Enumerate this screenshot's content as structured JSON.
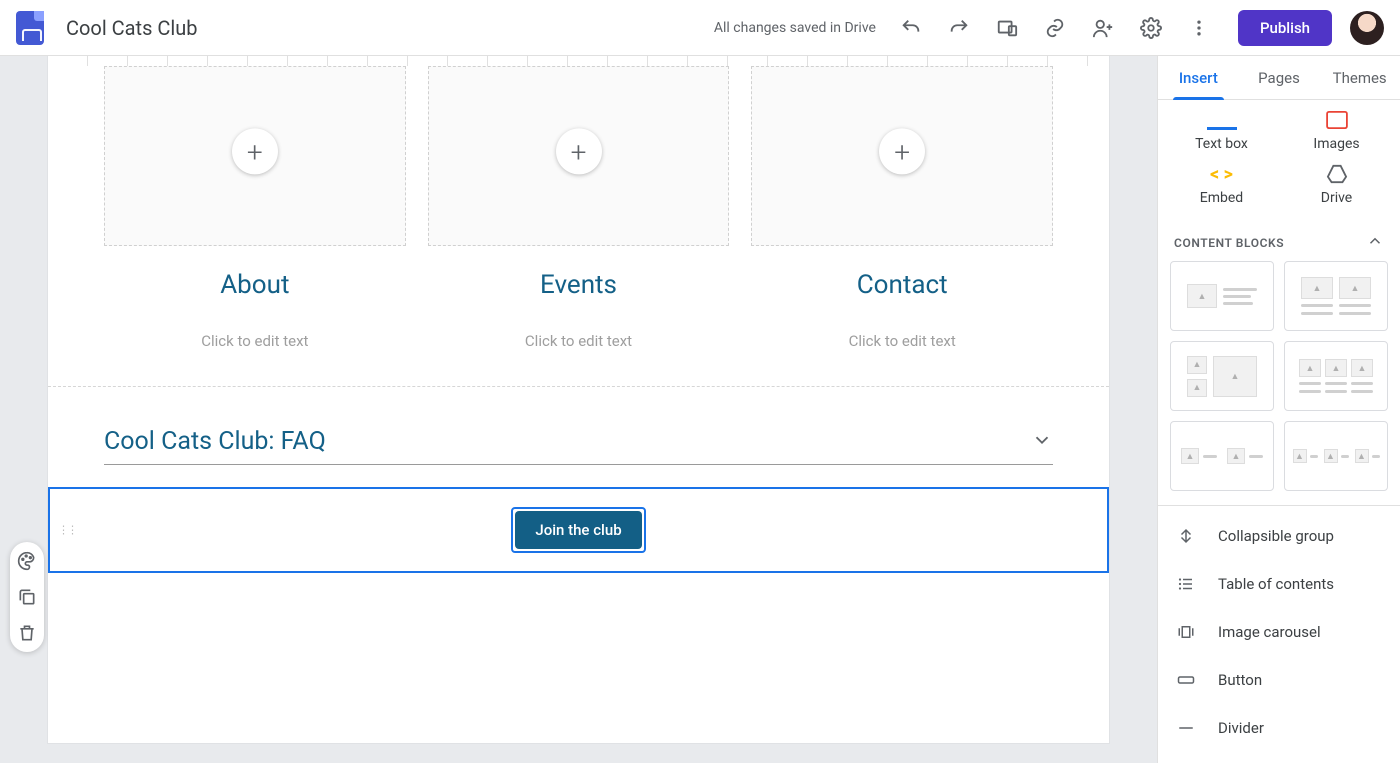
{
  "header": {
    "doc_title": "Cool Cats Club",
    "save_status": "All changes saved in Drive",
    "publish_label": "Publish",
    "icons": {
      "undo": "undo-icon",
      "redo": "redo-icon",
      "preview": "preview-icon",
      "link": "link-icon",
      "share": "person-add-icon",
      "settings": "gear-icon",
      "more": "more-vert-icon"
    }
  },
  "canvas": {
    "columns": [
      {
        "title": "About",
        "placeholder": "Click to edit text"
      },
      {
        "title": "Events",
        "placeholder": "Click to edit text"
      },
      {
        "title": "Contact",
        "placeholder": "Click to edit text"
      }
    ],
    "faq_title": "Cool Cats Club: FAQ",
    "cta_label": "Join the club"
  },
  "section_tools": {
    "palette": "palette-icon",
    "duplicate": "duplicate-icon",
    "delete": "trash-icon"
  },
  "sidebar": {
    "tabs": [
      "Insert",
      "Pages",
      "Themes"
    ],
    "active_tab": 0,
    "insert_icons": [
      {
        "label": "Text box",
        "id": "textbox"
      },
      {
        "label": "Images",
        "id": "images"
      },
      {
        "label": "Embed",
        "id": "embed"
      },
      {
        "label": "Drive",
        "id": "drive"
      }
    ],
    "content_blocks_header": "CONTENT BLOCKS",
    "insert_list": [
      "Collapsible group",
      "Table of contents",
      "Image carousel",
      "Button",
      "Divider"
    ]
  }
}
